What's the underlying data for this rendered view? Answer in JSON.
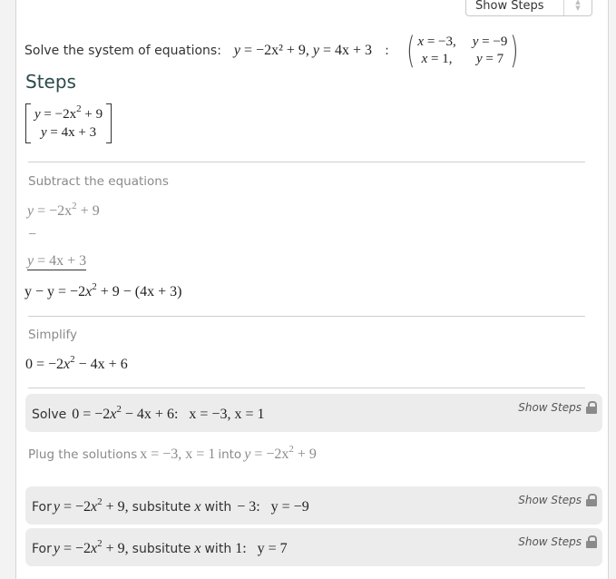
{
  "header": {
    "show_steps_select": "Show Steps",
    "problem_label": "Solve the system of equations:",
    "problem_eq1": "−2x² + 9",
    "problem_eq2": "4x + 3",
    "colon": ":",
    "solutions": [
      {
        "x": "−3",
        "y": "−9"
      },
      {
        "x": "1",
        "y": "7"
      }
    ]
  },
  "steps_title": "Steps",
  "system": {
    "eq1_rhs": "−2x",
    "eq1_tail": "+ 9",
    "eq2_rhs": "4x + 3"
  },
  "steps": {
    "subtract": {
      "title": "Subtract the equations",
      "minus_sign": "−",
      "result_lhs": "y − y =",
      "result_rhs_tail": "+ 9 − (4x + 3)"
    },
    "simplify": {
      "title": "Simplify",
      "result_tail": "− 4x + 6"
    },
    "solve_card": {
      "prefix": "Solve",
      "result": "x = −3, x = 1",
      "show_steps": "Show Steps"
    },
    "plug": {
      "prefix": "Plug the solutions",
      "solutions": "x = −3, x = 1",
      "into": "into"
    },
    "substitute_cards": [
      {
        "for": "For",
        "subst": "subsitute",
        "with": "with",
        "value": "− 3:",
        "result": "y = −9",
        "show_steps": "Show Steps"
      },
      {
        "for": "For",
        "subst": "subsitute",
        "with": "with",
        "value": "1:",
        "result": "y = 7",
        "show_steps": "Show Steps"
      }
    ]
  }
}
